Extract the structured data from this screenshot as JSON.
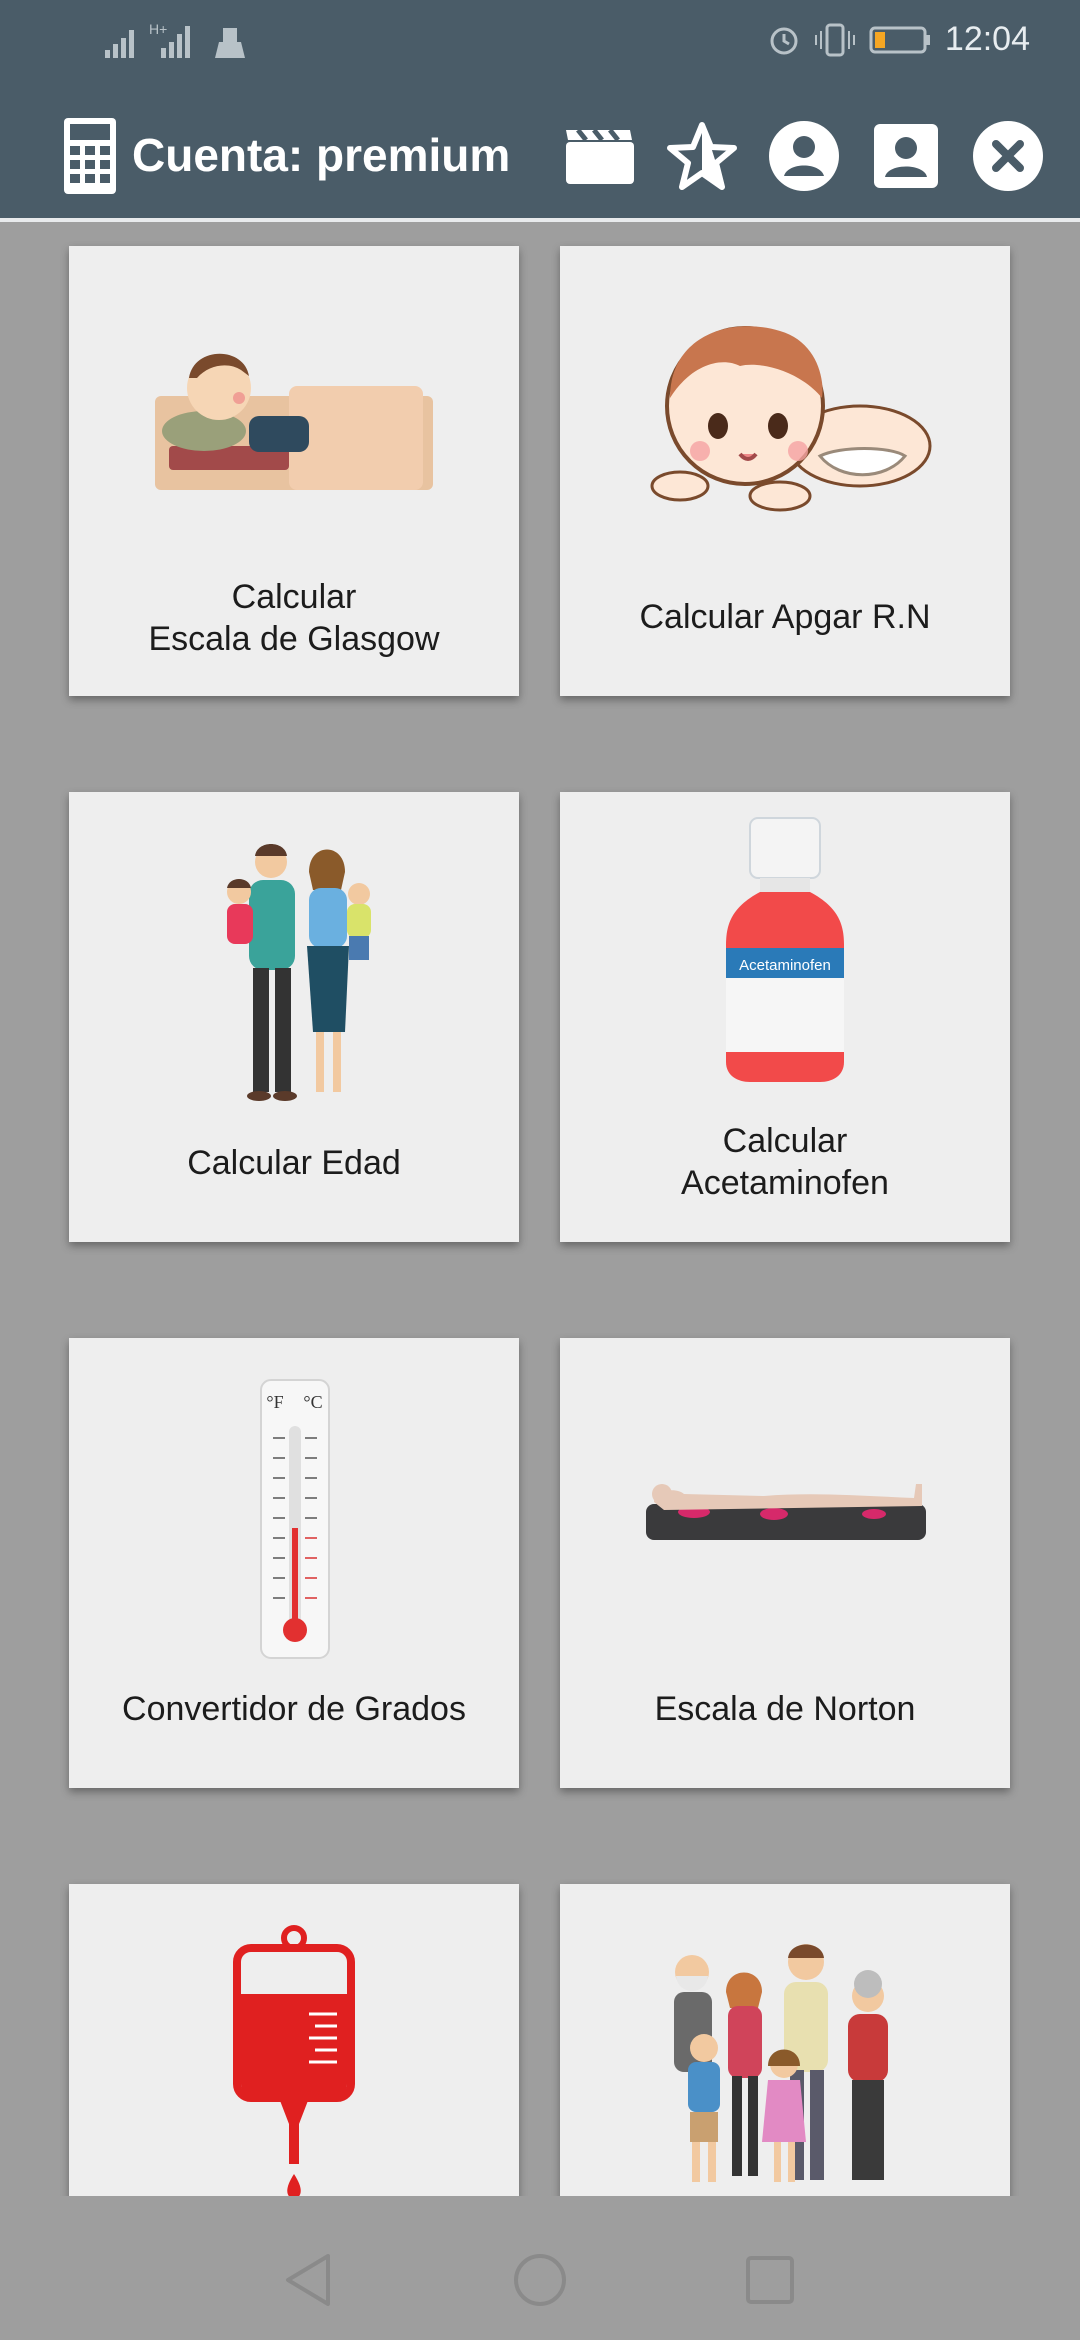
{
  "status_bar": {
    "time": "12:04",
    "icons": [
      "signal-icon",
      "hplus-signal-icon",
      "cleaner-icon",
      "alarm-icon",
      "vibrate-icon",
      "battery-icon"
    ]
  },
  "app_bar": {
    "title": "Cuenta: premium",
    "actions": [
      "video-icon",
      "rate-star-icon",
      "account-circle-icon",
      "contact-card-icon",
      "close-icon"
    ]
  },
  "cards": [
    {
      "label": "Calcular\nEscala de Glasgow",
      "icon": "patient-in-bed-icon"
    },
    {
      "label": "Calcular Apgar R.N",
      "icon": "baby-icon"
    },
    {
      "label": "Calcular Edad",
      "icon": "family-icon"
    },
    {
      "label": "Calcular\nAcetaminofen",
      "icon": "medicine-bottle-icon",
      "bottle_text": "Acetaminofen"
    },
    {
      "label": "Convertidor de Grados",
      "icon": "thermometer-icon",
      "thermo_units": [
        "°F",
        "°C"
      ]
    },
    {
      "label": "Escala de Norton",
      "icon": "patient-on-mattress-icon"
    },
    {
      "label": "",
      "icon": "blood-bag-icon"
    },
    {
      "label": "",
      "icon": "family-group-icon"
    }
  ],
  "nav_bar": [
    "back-icon",
    "home-icon",
    "recents-icon"
  ],
  "colors": {
    "app_bar": "#4a5c68",
    "background": "#9e9e9e",
    "card": "#eeeeee"
  }
}
